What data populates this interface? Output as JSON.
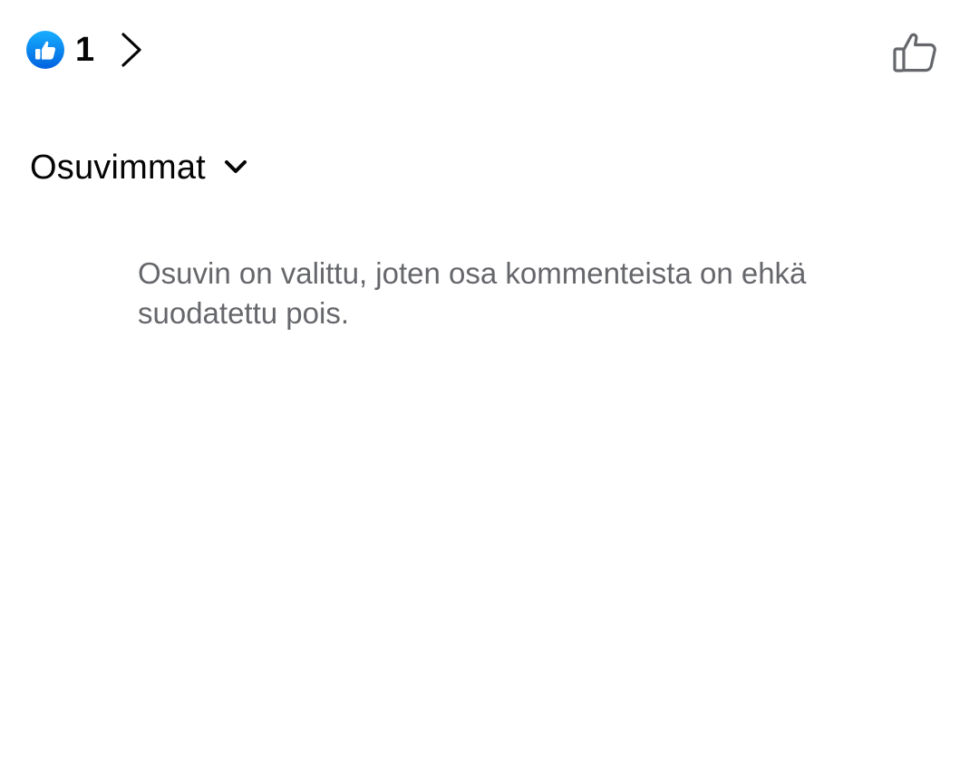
{
  "reactions": {
    "icon": "like-reaction-icon",
    "count": "1",
    "accent_color": "#1877f2"
  },
  "header": {
    "like_icon": "thumbs-up-outline-icon"
  },
  "sort": {
    "selected": "Osuvimmat",
    "icon": "chevron-down-icon"
  },
  "notice": {
    "text": "Osuvin on valittu, joten osa kommenteista on ehkä suodatettu pois."
  },
  "colors": {
    "primary_text": "#050505",
    "secondary_text": "#65676b",
    "icon_gray": "#65676b",
    "background": "#ffffff"
  }
}
